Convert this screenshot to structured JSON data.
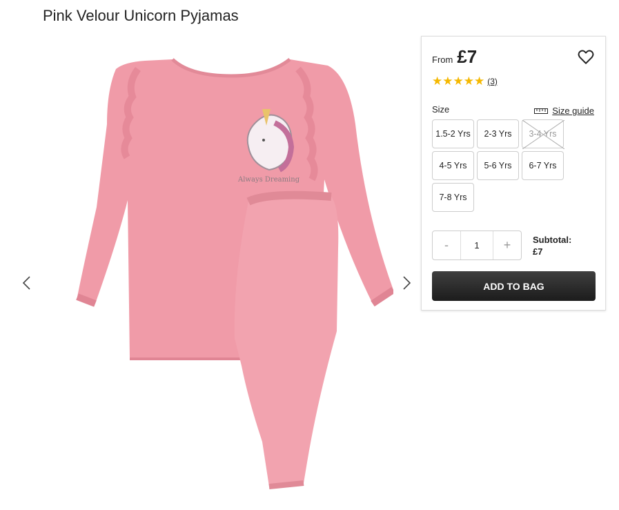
{
  "product": {
    "title": "Pink Velour Unicorn Pyjamas"
  },
  "gallery": {
    "prev_icon": "chevron-left-icon",
    "next_icon": "chevron-right-icon",
    "top_print": "Always Dreaming"
  },
  "buy_panel": {
    "from_label": "From",
    "price": "£7",
    "wishlist_icon": "heart-icon",
    "rating": {
      "stars": 5,
      "max": 5,
      "count": "(3)",
      "star_color": "#f5b800"
    },
    "size_label": "Size",
    "size_guide": {
      "label": "Size guide",
      "icon": "ruler-icon"
    },
    "sizes": [
      {
        "label": "1.5-2 Yrs",
        "available": true
      },
      {
        "label": "2-3 Yrs",
        "available": true
      },
      {
        "label": "3-4 Yrs",
        "available": false
      },
      {
        "label": "4-5 Yrs",
        "available": true
      },
      {
        "label": "5-6 Yrs",
        "available": true
      },
      {
        "label": "6-7 Yrs",
        "available": true
      },
      {
        "label": "7-8 Yrs",
        "available": true
      }
    ],
    "quantity": {
      "minus": "-",
      "value": "1",
      "plus": "+"
    },
    "subtotal": {
      "label": "Subtotal:",
      "value": "£7"
    },
    "add_to_bag": "ADD TO BAG",
    "button_color": "#2b2b2b"
  },
  "colors": {
    "garment": "#f0a0aa"
  }
}
